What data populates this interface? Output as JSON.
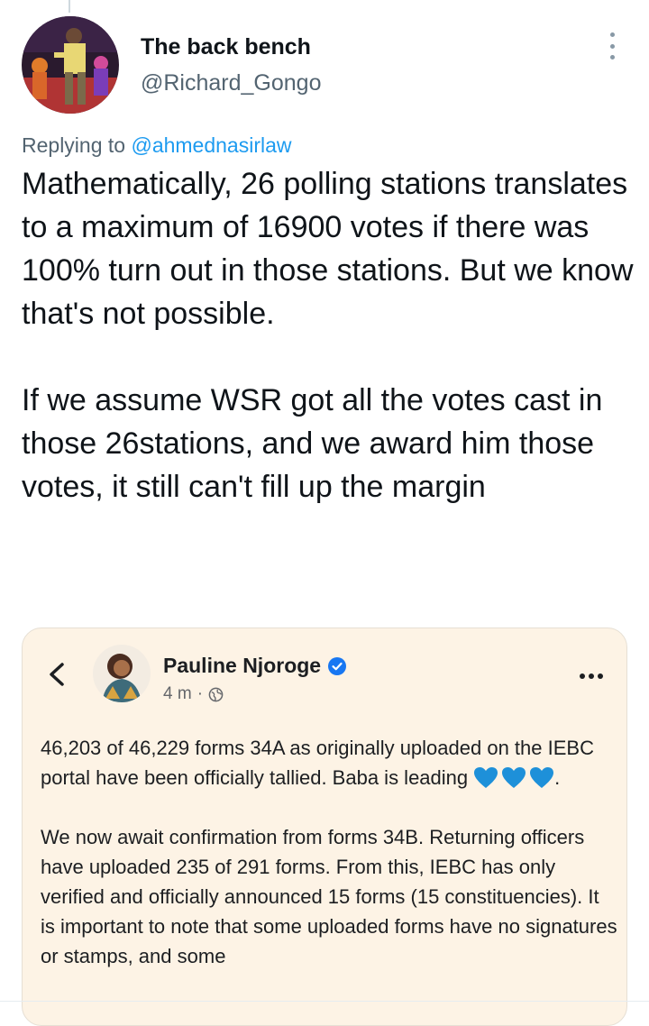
{
  "tweet": {
    "author_name": "The back bench",
    "author_handle": "@Richard_Gongo",
    "replying_prefix": "Replying to",
    "replying_to": "@ahmednasirlaw",
    "paragraph_1": "Mathematically, 26 polling stations translates to a maximum of 16900 votes if there was 100% turn out in those stations. But we know that's not possible.",
    "paragraph_2": "If we assume WSR got all the votes cast in those 26stations, and we award him those votes, it still can't fill up the margin"
  },
  "embedded_post": {
    "author_name": "Pauline Njoroge",
    "time": "4 m",
    "separator": "·",
    "paragraph_1_text": "46,203 of 46,229 forms 34A as originally uploaded on the IEBC portal have been officially tallied. Baba is leading",
    "paragraph_1_end": ".",
    "paragraph_2": "We now await confirmation from forms 34B. Returning officers have uploaded 235 of 291 forms. From this, IEBC has only verified and officially announced 15 forms (15 constituencies). It is important to note that some uploaded forms have no signatures or stamps, and some",
    "heart_emoji_count": 3,
    "heart_color": "#1e90d9"
  },
  "colors": {
    "text_primary": "#0f1419",
    "text_secondary": "#536471",
    "link_blue": "#1d9bf0",
    "card_background": "#fdf3e5"
  }
}
